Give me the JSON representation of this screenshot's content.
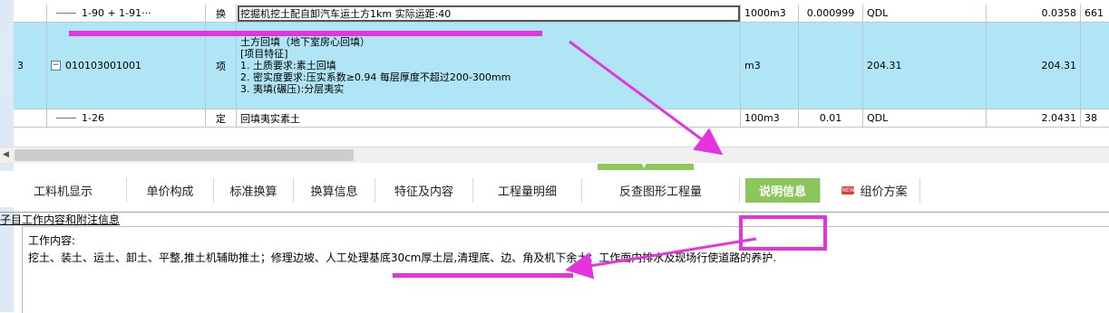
{
  "grid": {
    "rows": [
      {
        "id": "sub1",
        "index": "",
        "code": "1-90 + 1-91···",
        "type": "换",
        "desc": "挖掘机挖土配自卸汽车运土方1km  实际运距:40",
        "unit": "1000m3",
        "qty_factor": "0.000999",
        "qty_expr": "QDL",
        "qty": "0.0358",
        "price": "661"
      },
      {
        "id": "main",
        "index": "3",
        "code": "010103001001",
        "type": "项",
        "desc_lines": [
          "土方回填（地下室房心回填）",
          "[项目特征]",
          "1. 土质要求:素土回填",
          "2. 密实度要求:压实系数≥0.94 每层厚度不超过200-300mm",
          "3. 夷填(碾压):分层夷实"
        ],
        "unit": "m3",
        "qty_factor": "",
        "qty_expr": "204.31",
        "qty": "204.31",
        "price": ""
      },
      {
        "id": "sub2",
        "index": "",
        "code": "1-26",
        "type": "定",
        "desc": "回填夷实素土",
        "unit": "100m3",
        "qty_factor": "0.01",
        "qty_expr": "QDL",
        "qty": "2.0431",
        "price": "38"
      }
    ]
  },
  "tabs": [
    {
      "label": "工料机显示",
      "active": false
    },
    {
      "label": "单价构成",
      "active": false
    },
    {
      "label": "标准换算",
      "active": false
    },
    {
      "label": "换算信息",
      "active": false
    },
    {
      "label": "特征及内容",
      "active": false
    },
    {
      "label": "工程量明细",
      "active": false
    },
    {
      "label": "反查图形工程量",
      "active": false
    },
    {
      "label": "说明信息",
      "active": true
    },
    {
      "label": "组价方案",
      "active": false,
      "badge": "NEW"
    }
  ],
  "info": {
    "section_title": "子目工作内容和附注信息",
    "line1": "工作内容:",
    "line2": "挖土、装土、运土、卸土、平整,推土机辅助推土；修理边坡、人工处理基底30cm厚土层,清理底、边、角及机下余土；工作面内排水及现场行使道路的养护."
  },
  "colors": {
    "annotation": "#e533e0",
    "active_tab": "#8cc65a",
    "selected_row": "#b0e5f6"
  }
}
